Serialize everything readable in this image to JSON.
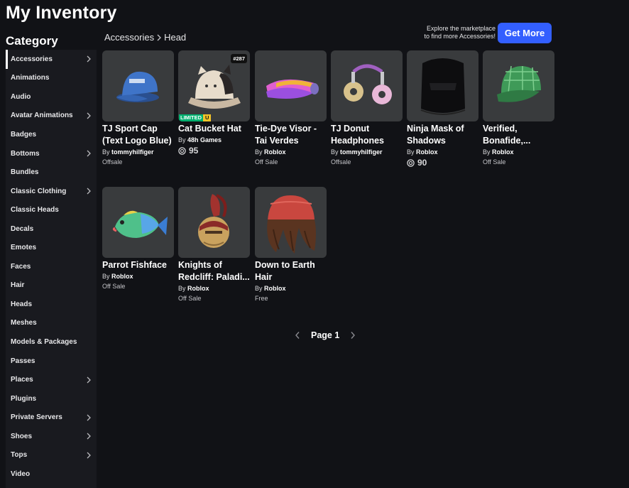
{
  "header": {
    "title": "My Inventory"
  },
  "sidebar": {
    "heading": "Category",
    "items": [
      {
        "label": "Accessories",
        "chevron": true,
        "active": true
      },
      {
        "label": "Animations",
        "chevron": false
      },
      {
        "label": "Audio",
        "chevron": false
      },
      {
        "label": "Avatar Animations",
        "chevron": true
      },
      {
        "label": "Badges",
        "chevron": false
      },
      {
        "label": "Bottoms",
        "chevron": true
      },
      {
        "label": "Bundles",
        "chevron": false
      },
      {
        "label": "Classic Clothing",
        "chevron": true
      },
      {
        "label": "Classic Heads",
        "chevron": false
      },
      {
        "label": "Decals",
        "chevron": false
      },
      {
        "label": "Emotes",
        "chevron": false
      },
      {
        "label": "Faces",
        "chevron": false
      },
      {
        "label": "Hair",
        "chevron": false
      },
      {
        "label": "Heads",
        "chevron": false
      },
      {
        "label": "Meshes",
        "chevron": false
      },
      {
        "label": "Models & Packages",
        "chevron": false
      },
      {
        "label": "Passes",
        "chevron": false
      },
      {
        "label": "Places",
        "chevron": true
      },
      {
        "label": "Plugins",
        "chevron": false
      },
      {
        "label": "Private Servers",
        "chevron": true
      },
      {
        "label": "Shoes",
        "chevron": true
      },
      {
        "label": "Tops",
        "chevron": true
      },
      {
        "label": "Video",
        "chevron": false
      }
    ]
  },
  "breadcrumb": {
    "parent": "Accessories",
    "current": "Head",
    "separator_icon": "chevron-right-icon"
  },
  "promo": {
    "line1": "Explore the marketplace",
    "line2": "to find more Accessories!",
    "button_label": "Get More",
    "button_color": "#335fff"
  },
  "items": [
    {
      "name": "TJ Sport Cap (Text Logo Blue)",
      "by": "By",
      "creator": "tommyhilfiger",
      "status": "Offsale",
      "thumb_icon": "blue-cap-thumbnail"
    },
    {
      "name": "Cat Bucket Hat",
      "by": "By",
      "creator": "48h Games",
      "price": "95",
      "serial": "#287",
      "limited_label": "LIMITED",
      "limited_u": "U",
      "thumb_icon": "cat-bucket-hat-thumbnail"
    },
    {
      "name": "Tie-Dye Visor - Tai Verdes",
      "by": "By",
      "creator": "Roblox",
      "status": "Off Sale",
      "thumb_icon": "tie-dye-visor-thumbnail"
    },
    {
      "name": "TJ Donut Headphones",
      "by": "By",
      "creator": "tommyhilfiger",
      "status": "Offsale",
      "thumb_icon": "donut-headphones-thumbnail"
    },
    {
      "name": "Ninja Mask of Shadows",
      "by": "By",
      "creator": "Roblox",
      "price": "90",
      "thumb_icon": "ninja-mask-thumbnail"
    },
    {
      "name": "Verified, Bonafide,...",
      "by": "By",
      "creator": "Roblox",
      "status": "Off Sale",
      "thumb_icon": "green-plaid-cap-thumbnail"
    },
    {
      "name": "Parrot Fishface",
      "by": "By",
      "creator": "Roblox",
      "status": "Off Sale",
      "thumb_icon": "parrot-fish-thumbnail"
    },
    {
      "name": "Knights of Redcliff: Paladi...",
      "by": "By",
      "creator": "Roblox",
      "status": "Off Sale",
      "thumb_icon": "knight-helmet-thumbnail"
    },
    {
      "name": "Down to Earth Hair",
      "by": "By",
      "creator": "Roblox",
      "status": "Free",
      "thumb_icon": "hair-beanie-thumbnail"
    }
  ],
  "pagination": {
    "label": "Page 1"
  },
  "colors": {
    "background": "#111216",
    "sidebar": "#191a1f",
    "card": "#393b3d",
    "limited_green": "#00b06f",
    "limited_yellow": "#f5c52a"
  }
}
